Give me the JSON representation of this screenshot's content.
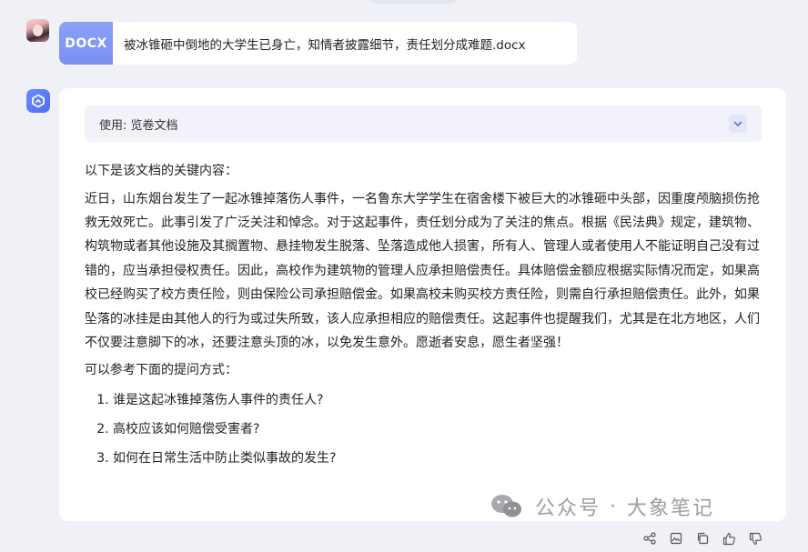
{
  "user": {
    "file_badge": "DOCX",
    "file_name": "被冰锥砸中倒地的大学生已身亡，知情者披露细节，责任划分成难题.docx"
  },
  "bot": {
    "tool_usage_label": "使用: 览卷文档",
    "intro": "以下是该文档的关键内容：",
    "summary": "近日，山东烟台发生了一起冰锥掉落伤人事件，一名鲁东大学学生在宿舍楼下被巨大的冰锥砸中头部，因重度颅脑损伤抢救无效死亡。此事引发了广泛关注和悼念。对于这起事件，责任划分成为了关注的焦点。根据《民法典》规定，建筑物、构筑物或者其他设施及其搁置物、悬挂物发生脱落、坠落造成他人损害，所有人、管理人或者使用人不能证明自己没有过错的，应当承担侵权责任。因此，高校作为建筑物的管理人应承担赔偿责任。具体赔偿金额应根据实际情况而定，如果高校已经购买了校方责任险，则由保险公司承担赔偿金。如果高校未购买校方责任险，则需自行承担赔偿责任。此外，如果坠落的冰挂是由其他人的行为或过失所致，该人应承担相应的赔偿责任。这起事件也提醒我们，尤其是在北方地区，人们不仅要注意脚下的冰，还要注意头顶的冰，以免发生意外。愿逝者安息，愿生者坚强！",
    "questions_intro": "可以参考下面的提问方式：",
    "questions": [
      "谁是这起冰锥掉落伤人事件的责任人?",
      "高校应该如何赔偿受害者?",
      "如何在日常生活中防止类似事故的发生?"
    ]
  },
  "watermark": {
    "text_a": "公众号",
    "dot": "·",
    "text_b": "大象笔记"
  },
  "icons": {
    "tool_toggle": "chevron-down-icon",
    "actions": [
      "share-icon",
      "image-icon",
      "copy-icon",
      "thumbs-up-icon",
      "thumbs-down-icon"
    ]
  },
  "colors": {
    "accent": "#6b82f3",
    "page_bg": "#f0f1f6",
    "card_bg": "#ffffff",
    "tool_bar_bg": "#f2f3fa"
  }
}
